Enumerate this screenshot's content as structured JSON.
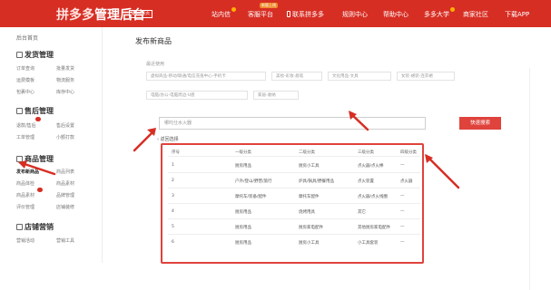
{
  "header": {
    "logo_brand": "拼多多",
    "logo_suffix": "管理后台",
    "back_home": "返回首页",
    "new_tag": "新版上线",
    "nav": [
      {
        "label": "站内信"
      },
      {
        "label": "客服平台"
      },
      {
        "label": "联系拼多多"
      },
      {
        "label": "规则中心"
      },
      {
        "label": "帮助中心"
      },
      {
        "label": "多多大学"
      },
      {
        "label": "商家社区"
      },
      {
        "label": "下载APP"
      }
    ]
  },
  "sidebar": {
    "home": "后台首页",
    "groups": [
      {
        "title": "发货管理",
        "items": [
          "订单查询",
          "批量发货",
          "运费模板",
          "物流服务",
          "包裹中心",
          "库存中心"
        ]
      },
      {
        "title": "售后管理",
        "items": [
          "退款/售后",
          "售后设置",
          "工单管理",
          "小额打款"
        ]
      },
      {
        "title": "商品管理",
        "items": [
          "发布新商品",
          "商品列表",
          "商品体检",
          "商品素材",
          "商品素材",
          "品牌管理",
          "评价管理",
          "店铺装修"
        ]
      },
      {
        "title": "店铺营销",
        "items": [
          "营销活动",
          "营销工具"
        ]
      }
    ]
  },
  "main": {
    "page_title": "发布新商品",
    "section_label": "最近使用",
    "recent_categories": [
      "虚拟商品-移动/联通/电信充值中心-手机卡",
      "美妆-彩妆-眉笔",
      "文化用品-文具",
      "女装-裙装-连衣裙",
      "电脑/办公-电脑周边-U盘",
      "家居-收纳"
    ],
    "search": {
      "placeholder": "哪吒仕水火器",
      "button": "快速搜索",
      "back_link": "返回选择"
    },
    "table": {
      "headers": [
        "序号",
        "一级分类",
        "二级分类",
        "三级分类",
        "四级分类"
      ],
      "rows": [
        {
          "no": "1",
          "c1": "厨房用品",
          "c2": "厨房小工具",
          "c3": "点火器/点火棒",
          "c4": "—"
        },
        {
          "no": "2",
          "c1": "户外/登山/野营/旅行",
          "c2": "炉具/锅具/野餐用品",
          "c3": "点火装置",
          "c4": "点火器"
        },
        {
          "no": "3",
          "c1": "摩托车/装备/配件",
          "c2": "摩托车配件",
          "c3": "点火器/点火线圈",
          "c4": "—"
        },
        {
          "no": "4",
          "c1": "厨房用品",
          "c2": "烧烤用具",
          "c3": "其它",
          "c4": "—"
        },
        {
          "no": "5",
          "c1": "厨房用品",
          "c2": "厨房家电配件",
          "c3": "其他厨房家电配件",
          "c4": "—"
        },
        {
          "no": "6",
          "c1": "厨房用品",
          "c2": "厨房小工具",
          "c3": "小工具套装",
          "c4": "—"
        }
      ]
    }
  },
  "colors": {
    "brand_red": "#d72e24",
    "accent_button": "#e0423c",
    "badge": "#ffb000"
  }
}
